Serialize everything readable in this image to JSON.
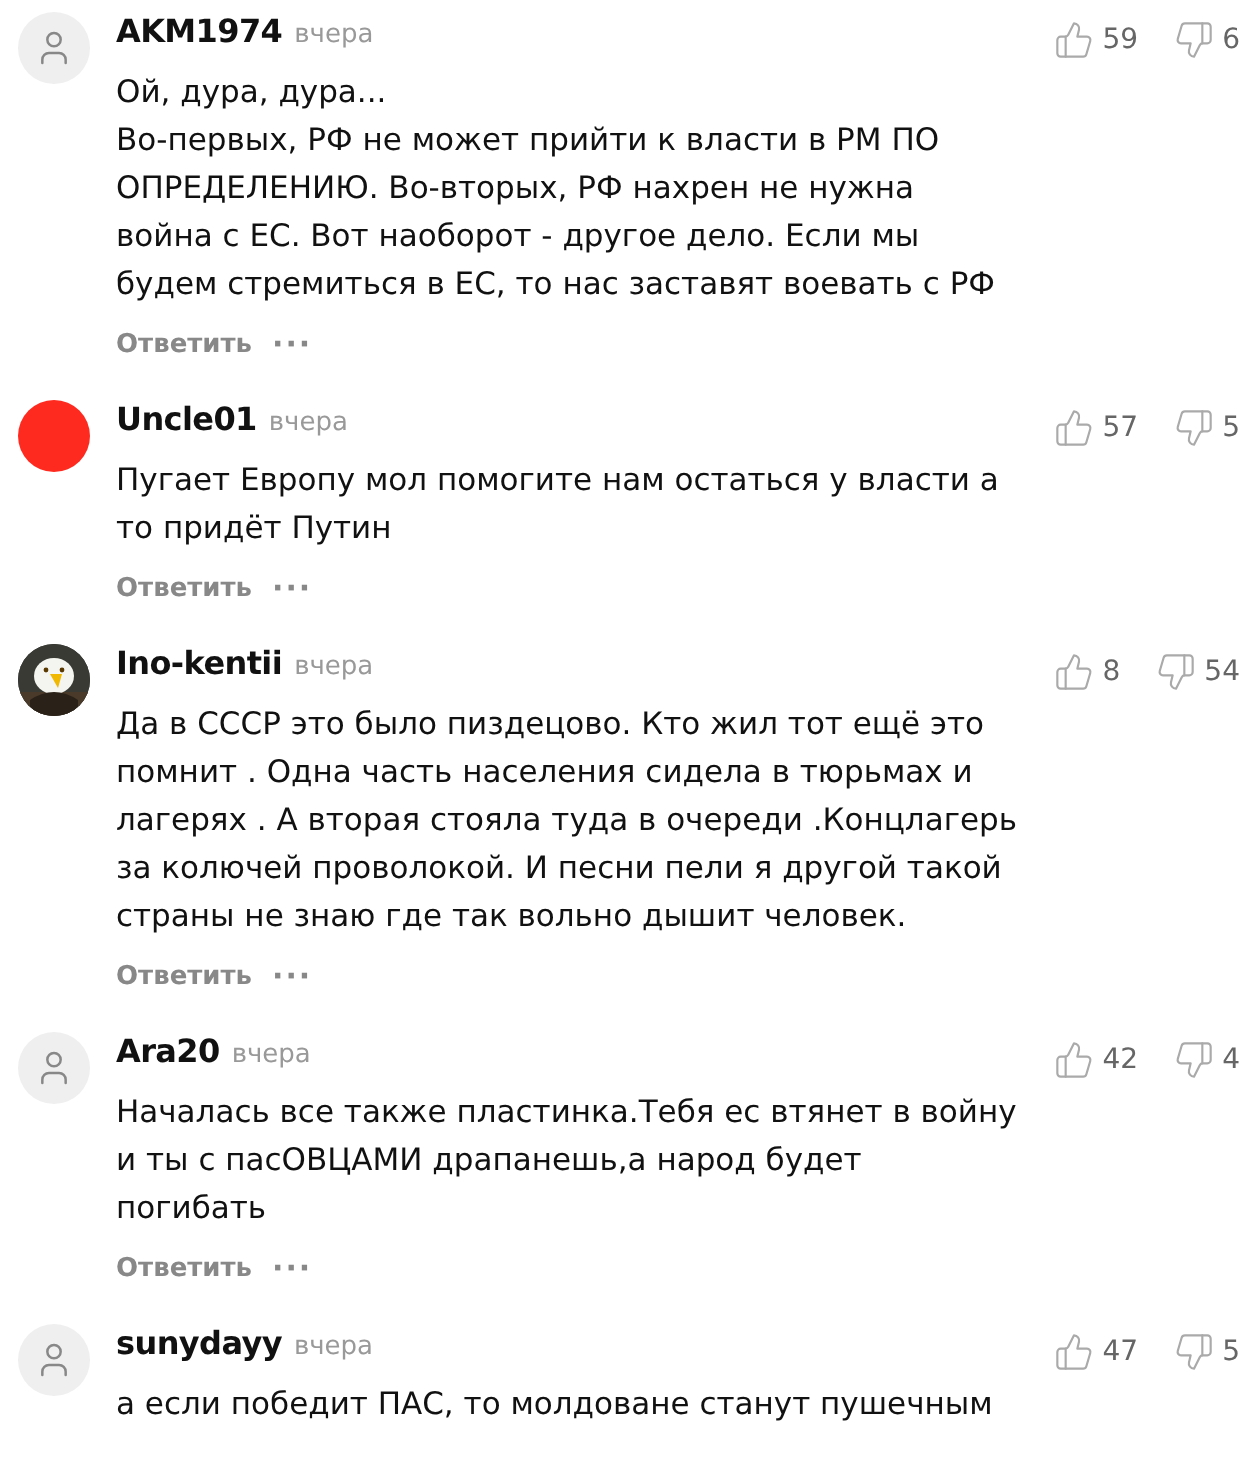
{
  "comments": [
    {
      "author": "AKM1974",
      "time": "вчера",
      "avatar": {
        "kind": "placeholder"
      },
      "likes": "59",
      "dislikes": "6",
      "text": "Ой, дура, дура...\nВо-первых, РФ не может прийти к власти в РМ ПО\nОПРЕДЕЛЕНИЮ. Во-вторых, РФ нахрен не нужна\nвойна с ЕС. Вот наоборот - другое дело. Если мы\nбудем стремиться в ЕС, то нас заставят воевать с РФ",
      "reply": "Ответить",
      "more": "···"
    },
    {
      "author": "Uncle01",
      "time": "вчера",
      "avatar": {
        "kind": "color",
        "color": "#ff2a1f"
      },
      "likes": "57",
      "dislikes": "5",
      "text": "Пугает Европу мол помогите нам остаться у власти а\nто придёт Путин",
      "reply": "Ответить",
      "more": "···"
    },
    {
      "author": "Ino-kentii",
      "time": "вчера",
      "likes": "8",
      "dislikes": "54",
      "text": "Да в СССР это было пиздецово. Кто жил тот ещё это\nпомнит . Одна часть населения сидела в тюрьмах и\nлагерях . А вторая стояла туда в очереди .Концлагерь\nза колючей проволокой. И песни пели я другой такой\nстраны не знаю где так вольно дышит человек.",
      "reply": "Ответить",
      "more": "···"
    },
    {
      "author": "Ara20",
      "time": "вчера",
      "avatar": {
        "kind": "placeholder"
      },
      "likes": "42",
      "dislikes": "4",
      "text": "Началась все также пластинка.Тебя ес втянет в войну\nи ты с пасОВЦАМИ драпанешь,а народ будет\nпогибать",
      "reply": "Ответить",
      "more": "···"
    },
    {
      "author": "sunydayy",
      "time": "вчера",
      "avatar": {
        "kind": "placeholder"
      },
      "likes": "47",
      "dislikes": "5",
      "text": "а если победит ПАС, то молдоване станут пушечным"
    }
  ]
}
